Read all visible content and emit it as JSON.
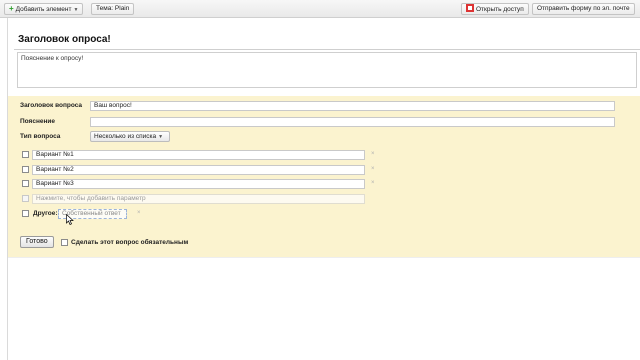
{
  "toolbar": {
    "add_element": "Добавить элемент",
    "theme": "Тема:  Plain",
    "open_access": "Открыть доступ",
    "send_email": "Отправить форму по эл. почте"
  },
  "form": {
    "title": "Заголовок опроса!",
    "description": "Пояснение к опросу!"
  },
  "question": {
    "title_label": "Заголовок вопроса",
    "title_value": "Ваш вопрос!",
    "hint_label": "Пояснение",
    "hint_value": "",
    "type_label": "Тип вопроса",
    "type_value": "Несколько из списка",
    "options": [
      "Вариант №1",
      "Вариант №2",
      "Вариант №3"
    ],
    "add_option_placeholder": "Нажмите, чтобы добавить параметр",
    "other_label": "Другое:",
    "other_placeholder": "Собственный ответ",
    "remove_glyph": "×",
    "done_label": "Готово",
    "required_label": "Сделать этот вопрос обязательным"
  }
}
